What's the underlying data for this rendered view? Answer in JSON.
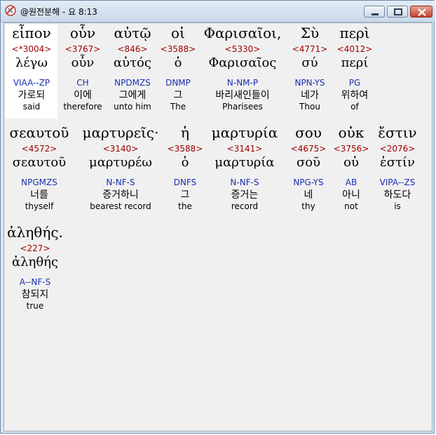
{
  "window": {
    "title": "@원전분해 - 요 8:13",
    "buttons": {
      "minimize": "minimize",
      "maximize": "maximize",
      "close": "close"
    }
  },
  "words": [
    {
      "greek": "εἶπον",
      "strong": "<*3004>",
      "lemma": "λέγω",
      "morph": "VIAA--ZP",
      "korean": "가로되",
      "english": "said"
    },
    {
      "greek": "οὖν",
      "strong": "<3767>",
      "lemma": "οὖν",
      "morph": "CH",
      "korean": "이에",
      "english": "therefore"
    },
    {
      "greek": "αὐτῷ",
      "strong": "<846>",
      "lemma": "αὐτός",
      "morph": "NPDMZS",
      "korean": "그에게",
      "english": "unto him"
    },
    {
      "greek": "οἱ",
      "strong": "<3588>",
      "lemma": "ὁ",
      "morph": "DNMP",
      "korean": "그",
      "english": "The"
    },
    {
      "greek": "Φαρισαῖοι,",
      "strong": "<5330>",
      "lemma": "Φαρισαῖος",
      "morph": "N-NM-P",
      "korean": "바리새인들이",
      "english": "Pharisees"
    },
    {
      "greek": "Σὺ",
      "strong": "<4771>",
      "lemma": "σύ",
      "morph": "NPN-YS",
      "korean": "네가",
      "english": "Thou"
    },
    {
      "greek": "περὶ",
      "strong": "<4012>",
      "lemma": "περί",
      "morph": "PG",
      "korean": "위하여",
      "english": "of"
    },
    {
      "greek": "σεαυτοῦ",
      "strong": "<4572>",
      "lemma": "σεαυτοῦ",
      "morph": "NPGMZS",
      "korean": "너를",
      "english": "thyself"
    },
    {
      "greek": "μαρτυρεῖς·",
      "strong": "<3140>",
      "lemma": "μαρτυρέω",
      "morph": "N-NF-S",
      "korean": "증거하니",
      "english": "bearest record"
    },
    {
      "greek": "ἡ",
      "strong": "<3588>",
      "lemma": "ὁ",
      "morph": "DNFS",
      "korean": "그",
      "english": "the"
    },
    {
      "greek": "μαρτυρία",
      "strong": "<3141>",
      "lemma": "μαρτυρία",
      "morph": "N-NF-S",
      "korean": "증거는",
      "english": "record"
    },
    {
      "greek": "σου",
      "strong": "<4675>",
      "lemma": "σοῦ",
      "morph": "NPG-YS",
      "korean": "네",
      "english": "thy"
    },
    {
      "greek": "οὐκ",
      "strong": "<3756>",
      "lemma": "οὐ",
      "morph": "AB",
      "korean": "아니",
      "english": "not"
    },
    {
      "greek": "ἔστιν",
      "strong": "<2076>",
      "lemma": "ἐστίν",
      "morph": "VIPA--ZS",
      "korean": "하도다",
      "english": "is"
    },
    {
      "greek": "ἀληθής.",
      "strong": "<227>",
      "lemma": "ἀληθής",
      "morph": "A--NF-S",
      "korean": "참되지",
      "english": "true"
    }
  ]
}
